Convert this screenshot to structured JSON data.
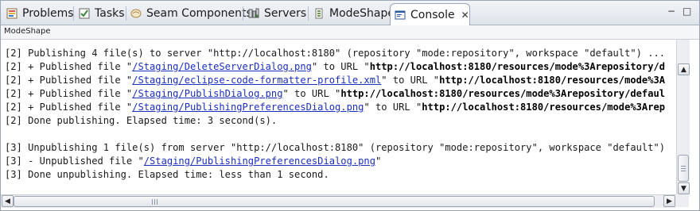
{
  "tabs": [
    {
      "label": "Problems",
      "icon": "problems-icon"
    },
    {
      "label": "Tasks",
      "icon": "tasks-icon"
    },
    {
      "label": "Seam Components",
      "icon": "seam-components-icon"
    },
    {
      "label": "Servers",
      "icon": "servers-icon"
    },
    {
      "label": "ModeShape",
      "icon": "modeshape-icon"
    },
    {
      "label": "Console",
      "icon": "console-icon",
      "active": true,
      "close_glyph": "✕"
    }
  ],
  "window_controls": {
    "minimize": "−",
    "maximize": "□"
  },
  "console": {
    "name": "ModeShape",
    "lines": [
      {
        "parts": [
          {
            "t": "[2] Publishing 4 file(s) to server \"http://localhost:8180\" (repository \"mode:repository\", workspace \"default\") ..."
          }
        ]
      },
      {
        "parts": [
          {
            "t": "[2] + Published file \""
          },
          {
            "t": "/Staging/DeleteServerDialog.png",
            "style": "link"
          },
          {
            "t": "\" to URL \""
          },
          {
            "t": "http://localhost:8180/resources/mode%3Arepository/d",
            "style": "bold"
          }
        ]
      },
      {
        "parts": [
          {
            "t": "[2] + Published file \""
          },
          {
            "t": "/Staging/eclipse-code-formatter-profile.xml",
            "style": "link"
          },
          {
            "t": "\" to URL \""
          },
          {
            "t": "http://localhost:8180/resources/mode%3A",
            "style": "bold"
          }
        ]
      },
      {
        "parts": [
          {
            "t": "[2] + Published file \""
          },
          {
            "t": "/Staging/PublishDialog.png",
            "style": "link"
          },
          {
            "t": "\" to URL \""
          },
          {
            "t": "http://localhost:8180/resources/mode%3Arepository/defaul",
            "style": "bold"
          }
        ]
      },
      {
        "parts": [
          {
            "t": "[2] + Published file \""
          },
          {
            "t": "/Staging/PublishingPreferencesDialog.png",
            "style": "link"
          },
          {
            "t": "\" to URL \""
          },
          {
            "t": "http://localhost:8180/resources/mode%3Arep",
            "style": "bold"
          }
        ]
      },
      {
        "parts": [
          {
            "t": "[2] Done publishing. Elapsed time: 3 second(s)."
          }
        ]
      },
      {
        "parts": [
          {
            "t": ""
          }
        ]
      },
      {
        "parts": [
          {
            "t": "[3] Unpublishing 1 file(s) from server \"http://localhost:8180\" (repository \"mode:repository\", workspace \"default\")"
          }
        ]
      },
      {
        "parts": [
          {
            "t": "[3] - Unpublished file \""
          },
          {
            "t": "/Staging/PublishingPreferencesDialog.png",
            "style": "link"
          },
          {
            "t": "\""
          }
        ]
      },
      {
        "parts": [
          {
            "t": "[3] Done unpublishing. Elapsed time: less than 1 second."
          }
        ]
      }
    ]
  },
  "colors": {
    "link": "#1a2ec0",
    "text": "#1a1a1a",
    "tab_bar": "#dfe4ea",
    "border": "#9aa5b5"
  }
}
